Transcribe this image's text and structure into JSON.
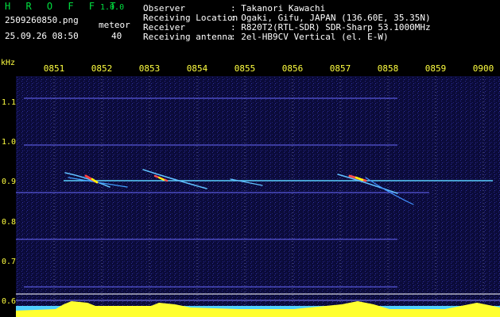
{
  "header": {
    "app_name": "H R O F F T",
    "version": "1.0.0",
    "filename": "2509260850.png",
    "timestamp": "25.09.26 08:50",
    "meteor_label": "meteor",
    "meteor_count": "40",
    "info": [
      {
        "label": "Observer",
        "value": ": Takanori Kawachi"
      },
      {
        "label": "Receiving Location",
        "value": ": Ogaki, Gifu, JAPAN (136.60E, 35.35N)"
      },
      {
        "label": "Receiver",
        "value": ": R820T2(RTL-SDR) SDR-Sharp 53.1000MHz"
      },
      {
        "label": "Receiving antenna",
        "value": ": 2el-HB9CV Vertical (el. E-W)"
      }
    ]
  },
  "axis": {
    "unit": "kHz",
    "freq_labels": [
      "1.1",
      "1.0",
      "0.9",
      "0.8",
      "0.7",
      "0.6"
    ],
    "time_labels": [
      "0851",
      "0852",
      "0853",
      "0854",
      "0855",
      "0856",
      "0857",
      "0858",
      "0859",
      "0900"
    ]
  },
  "colors": {
    "background": "#000000",
    "spectrum_bg": "#0b0b3a",
    "label_yellow": "#ffff40",
    "accent_green": "#00e040",
    "meteor_trace": "#60c0ff"
  }
}
